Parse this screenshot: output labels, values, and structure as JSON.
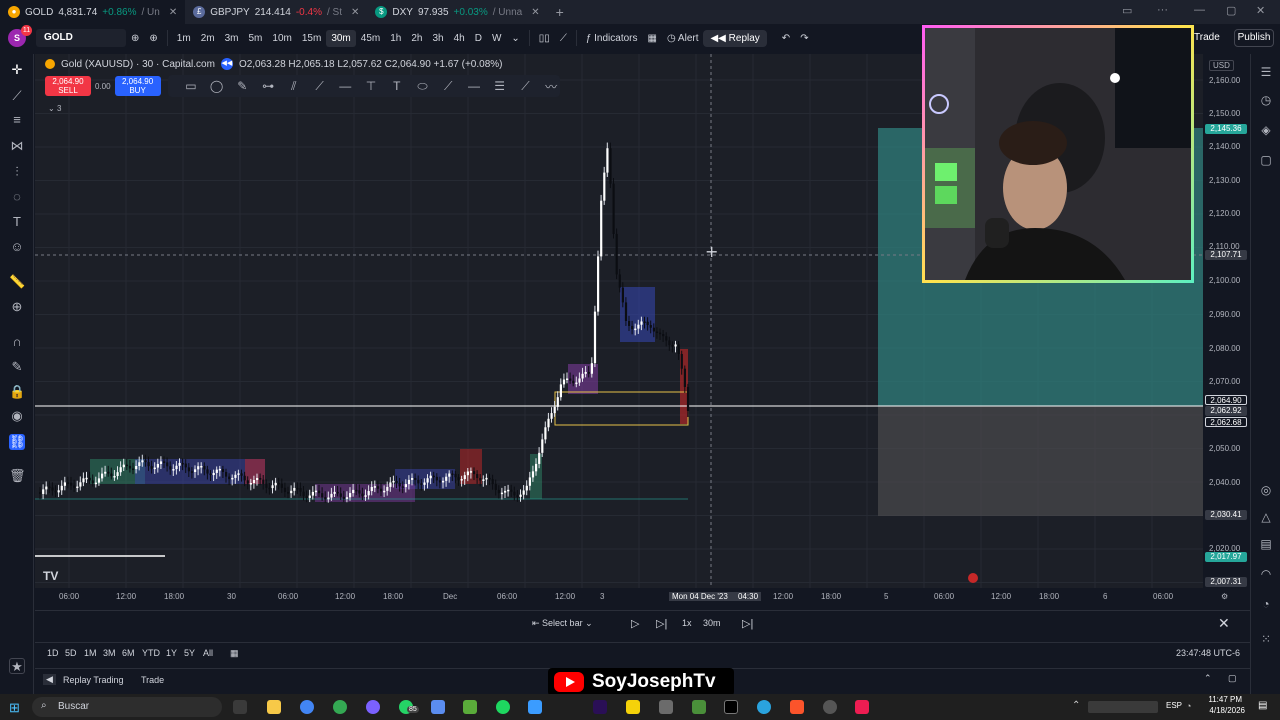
{
  "tabs": [
    {
      "title": "GOLD",
      "price": "4,831.74",
      "change": "+0.86%",
      "suffix": "/ Un"
    },
    {
      "title": "GBPJPY",
      "price": "214.414",
      "change": "-0.4%",
      "suffix": "/ St"
    },
    {
      "title": "DXY",
      "price": "97.935",
      "change": "+0.03%",
      "suffix": "/ Unna"
    }
  ],
  "toolbar": {
    "avatar_letter": "S",
    "avatar_badge": "11",
    "symbol": "GOLD",
    "intervals": [
      "1m",
      "2m",
      "3m",
      "5m",
      "10m",
      "15m",
      "30m",
      "45m",
      "1h",
      "2h",
      "3h",
      "4h",
      "D",
      "W"
    ],
    "selected_interval": "30m",
    "indicators": "Indicators",
    "alert": "Alert",
    "replay": "Replay",
    "trade": "Trade",
    "publish": "Publish"
  },
  "legend": {
    "name": "Gold (XAUUSD) · 30 · Capital.com",
    "ohlc": "O2,063.28 H2,065.18 L2,057.62 C2,064.90 +1.67 (+0.08%)",
    "sell_price": "2,064.90",
    "sell_label": "SELL",
    "spread": "0.00",
    "buy_price": "2,064.90",
    "buy_label": "BUY",
    "collapsed_count": "3"
  },
  "price_axis": {
    "currency": "USD",
    "levels": [
      "2,160.00",
      "2,150.00",
      "2,140.00",
      "2,130.00",
      "2,120.00",
      "2,110.00",
      "2,100.00",
      "2,090.00",
      "2,080.00",
      "2,070.00",
      "2,060.00",
      "2,050.00",
      "2,040.00",
      "2,020.00"
    ],
    "tags": [
      {
        "label": "2,145.36",
        "color": "#26a69a"
      },
      {
        "label": "2,107.71",
        "color": "#363a45"
      },
      {
        "label": "2,064.90",
        "color": "#131722"
      },
      {
        "label": "2,062.92",
        "color": "#363a45"
      },
      {
        "label": "2,062.68",
        "color": "#131722"
      },
      {
        "label": "2,030.41",
        "color": "#363a45"
      },
      {
        "label": "2,017.97",
        "color": "#26a69a"
      },
      {
        "label": "2,007.31",
        "color": "#363a45"
      }
    ]
  },
  "time_axis": {
    "labels": [
      "06:00",
      "12:00",
      "18:00",
      "30",
      "06:00",
      "12:00",
      "18:00",
      "Dec",
      "06:00",
      "12:00",
      "3",
      "12:00",
      "18:00",
      "5",
      "06:00",
      "12:00",
      "18:00",
      "6",
      "06:00"
    ],
    "cursor_label": "Mon 04 Dec '23",
    "cursor_time": "04:30"
  },
  "replay_bar": {
    "select_bar": "Select bar",
    "speed": "1x",
    "interval": "30m"
  },
  "range_bar": {
    "ranges": [
      "1D",
      "5D",
      "1M",
      "3M",
      "6M",
      "YTD",
      "1Y",
      "5Y",
      "All"
    ],
    "clock": "23:47:48 UTC-6"
  },
  "bottom_panel": {
    "replay_trading": "Replay Trading",
    "trade": "Trade"
  },
  "overlay": {
    "channel": "SoyJosephTv"
  },
  "taskbar": {
    "search": "Buscar",
    "badge": "85",
    "lang": "ESP",
    "time": "11:47 PM",
    "date": "4/18/2026"
  }
}
